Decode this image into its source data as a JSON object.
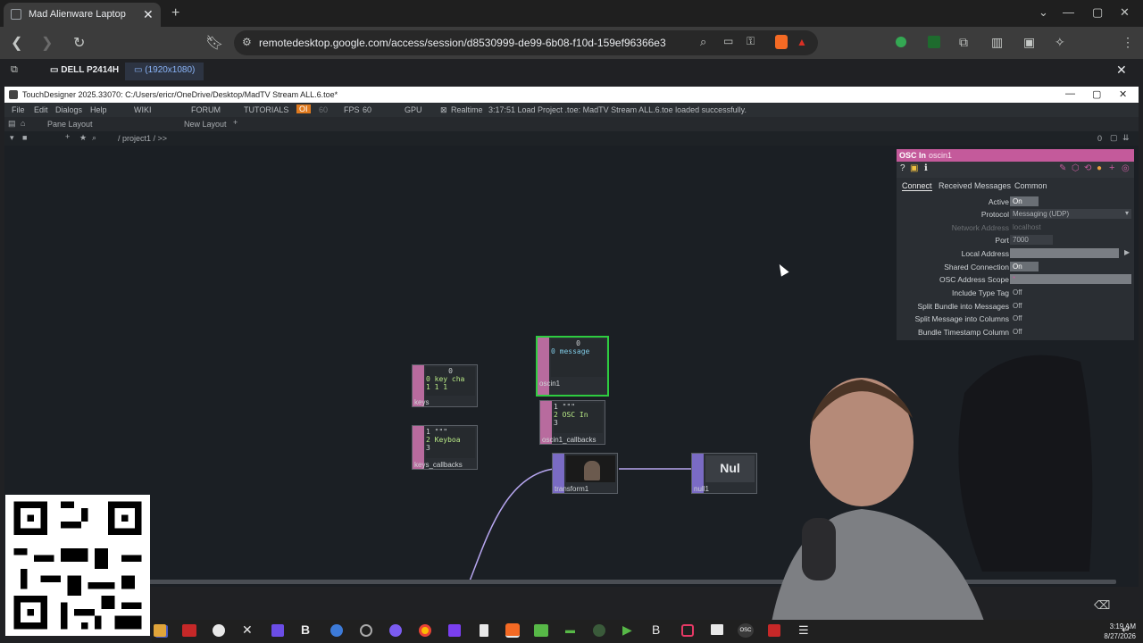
{
  "browser": {
    "tab_title": "Mad Alienware Laptop",
    "url": "remotedesktop.google.com/access/session/d8530999-de99-6b08-f10d-159ef96366e3"
  },
  "remote": {
    "display_name": "DELL P2414H",
    "resolution": "(1920x1080)"
  },
  "td": {
    "window_title": "TouchDesigner 2025.33070: C:/Users/ericr/OneDrive/Desktop/MadTV Stream ALL.6.toe*",
    "menu": [
      "File",
      "Edit",
      "Dialogs",
      "Help",
      "WIKI",
      "FORUM",
      "TUTORIALS"
    ],
    "oi_badge": "OI",
    "fps_cook": "60",
    "fps_label": "FPS",
    "fps_value": "60",
    "gpu_label": "GPU",
    "realtime_label": "Realtime",
    "status_message": "3:17:51 Load Project .toe: MadTV Stream ALL.6.toe loaded successfully.",
    "pane_layout": "Pane Layout",
    "new_layout": "New Layout",
    "path": "/ project1 / >>",
    "pane_counter": "0"
  },
  "nodes": {
    "keys": {
      "label": "keys",
      "top": "0",
      "row1": "0  key  cha",
      "row2": "1 1    1"
    },
    "keys_callbacks": {
      "label": "keys_callbacks",
      "l1": "1  \"\"\"",
      "l2": "2  Keyboa",
      "l3": "3"
    },
    "oscin1": {
      "label": "oscin1",
      "top": "0",
      "row1": "0  message"
    },
    "oscin1_callbacks": {
      "label": "oscin1_callbacks",
      "l1": "1  \"\"\"",
      "l2": "2  OSC In",
      "l3": "3"
    },
    "transform1": {
      "label": "transform1"
    },
    "null1": {
      "label": "null1",
      "text": "Nul"
    }
  },
  "params": {
    "op_type": "OSC In",
    "op_name": "oscin1",
    "tabs": [
      "Connect",
      "Received Messages",
      "Common"
    ],
    "rows": [
      {
        "label": "Active",
        "value": "On"
      },
      {
        "label": "Protocol",
        "value": "Messaging (UDP)"
      },
      {
        "label": "Network Address",
        "value": "localhost"
      },
      {
        "label": "Port",
        "value": "7000"
      },
      {
        "label": "Local Address",
        "value": ""
      },
      {
        "label": "Shared Connection",
        "value": "On"
      },
      {
        "label": "OSC Address Scope",
        "value": "*"
      },
      {
        "label": "Include Type Tag",
        "value": "Off"
      },
      {
        "label": "Split Bundle into Messages",
        "value": "Off"
      },
      {
        "label": "Split Message into Columns",
        "value": "Off"
      },
      {
        "label": "Bundle Timestamp Column",
        "value": "Off"
      }
    ]
  },
  "taskbar": {
    "time": "3:19 AM",
    "date": "8/27/2026"
  },
  "colors": {
    "accent_pink": "#c45a9b",
    "selection_green": "#2ecc40",
    "wire_lavender": "#b7a6f0"
  }
}
